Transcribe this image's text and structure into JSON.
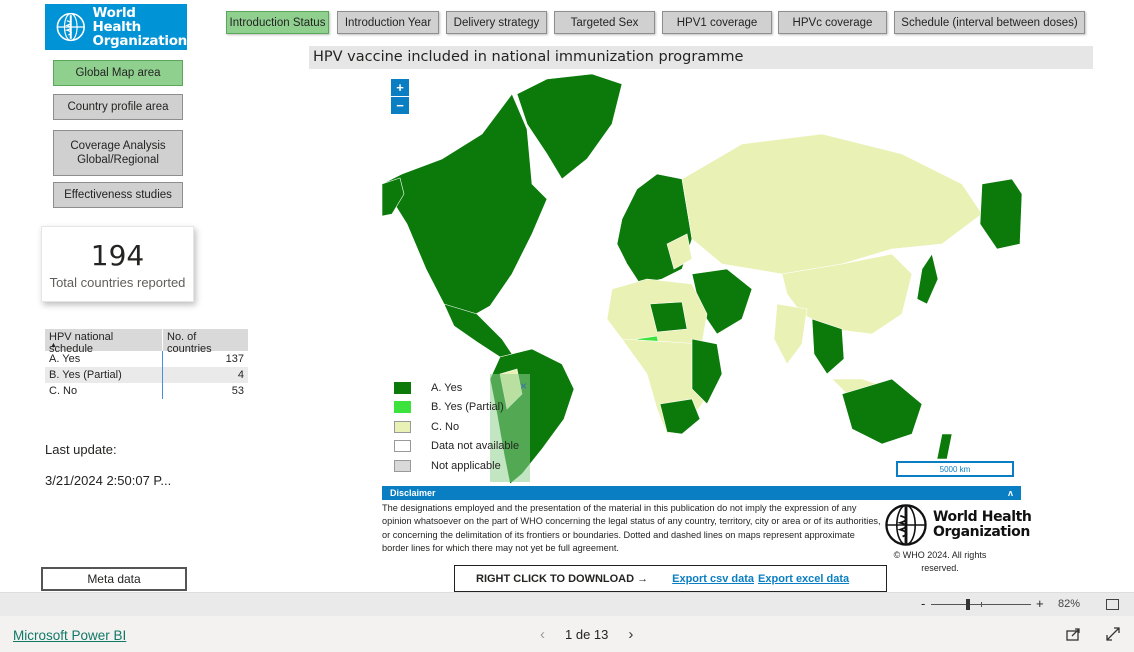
{
  "header": {
    "logo_line1": "World Health",
    "logo_line2": "Organization"
  },
  "tabs": [
    {
      "label": "Introduction Status",
      "active": true
    },
    {
      "label": "Introduction Year",
      "active": false
    },
    {
      "label": "Delivery strategy",
      "active": false
    },
    {
      "label": "Targeted Sex",
      "active": false
    },
    {
      "label": "HPV1 coverage",
      "active": false
    },
    {
      "label": "HPVc coverage",
      "active": false
    },
    {
      "label": "Schedule (interval between doses)",
      "active": false
    }
  ],
  "sidebar": {
    "items": [
      {
        "label": "Global Map area",
        "active": true
      },
      {
        "label": "Country profile area",
        "active": false
      },
      {
        "label": "Coverage Analysis Global/Regional",
        "active": false
      },
      {
        "label": "Effectiveness studies",
        "active": false
      }
    ]
  },
  "kpi": {
    "value": "194",
    "label": "Total countries reported"
  },
  "schedule_table": {
    "headers": [
      "HPV national schedule",
      "No. of countries"
    ],
    "rows": [
      {
        "label": "A. Yes",
        "count": "137"
      },
      {
        "label": "B. Yes (Partial)",
        "count": "4"
      },
      {
        "label": "C. No",
        "count": "53"
      }
    ]
  },
  "last_update": {
    "label": "Last update:",
    "value": "3/21/2024 2:50:07 P..."
  },
  "meta_button": "Meta data",
  "map": {
    "title": "HPV vaccine included in national immunization programme",
    "zoom_in": "+",
    "zoom_out": "−",
    "scale_label": "5000 km",
    "legend": [
      {
        "label": "A. Yes",
        "color": "#0b7a0b"
      },
      {
        "label": "B. Yes (Partial)",
        "color": "#3de33d"
      },
      {
        "label": "C. No",
        "color": "#eaf1b5"
      },
      {
        "label": "Data not available",
        "color": "#ffffff"
      },
      {
        "label": "Not applicable",
        "color": "#d9d9d9"
      }
    ],
    "legend_close": "×"
  },
  "disclaimer": {
    "title": "Disclaimer",
    "toggle": "ʌ",
    "text": "The designations employed and the presentation of the material in this publication do not imply the expression of any opinion whatsoever on the part of WHO concerning the legal status of any country, territory, city or area or of its authorities, or concerning the delimitation of its frontiers or boundaries. Dotted and dashed lines on maps represent approximate border lines for which there may not yet be full agreement.",
    "logo_line1": "World Health",
    "logo_line2": "Organization",
    "copyright": "© WHO 2024. All rights reserved."
  },
  "download": {
    "instruction": "RIGHT CLICK TO DOWNLOAD →",
    "csv_label": "Export csv data",
    "excel_label": "Export excel data"
  },
  "footer": {
    "zoom_minus": "-",
    "zoom_plus": "+",
    "zoom_level": "82%",
    "zoom_fraction": 0.37,
    "powerbi_link": "Microsoft Power BI",
    "page_indicator": "1 de 13",
    "prev": "‹",
    "next": "›"
  },
  "colors": {
    "who_blue": "#0093d5",
    "accent_blue": "#0a7ec2",
    "active_green": "#8fd08f",
    "country_yes": "#0b7a0b",
    "country_partial": "#3de33d",
    "country_no": "#eaf1b5",
    "country_na": "#d9d9d9"
  }
}
